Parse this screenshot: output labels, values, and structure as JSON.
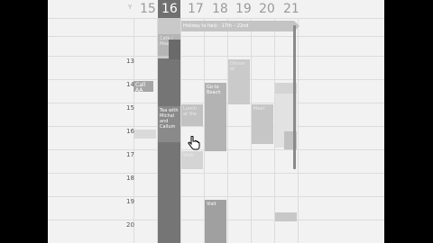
{
  "week": {
    "partial_label": "Y",
    "days": [
      {
        "num": "15",
        "selected": false
      },
      {
        "num": "16",
        "selected": true
      },
      {
        "num": "17",
        "selected": false
      },
      {
        "num": "18",
        "selected": false
      },
      {
        "num": "19",
        "selected": false
      },
      {
        "num": "20",
        "selected": false
      },
      {
        "num": "21",
        "selected": false
      }
    ]
  },
  "hours": [
    "13",
    "14",
    "15",
    "16",
    "17",
    "18",
    "19",
    "20"
  ],
  "events": {
    "holiday_banner": "Holiday to Italy · 17th – 22nd",
    "call_aa": "Call AA",
    "tea": "Tea with Michal and Callum",
    "go_to_beach": "Go to Beach",
    "lunch": "Lunch at the",
    "meet": "Meet",
    "dinner": "Dinner at",
    "visit": "Visit",
    "walk": "Walk",
    "top_sel": "Cafe / Meeting"
  },
  "colors": {
    "bg": "#f2f2f2",
    "selected_day": "#707070",
    "event_gray": "#c2c2c2",
    "event_dark": "#8c8c8c"
  }
}
